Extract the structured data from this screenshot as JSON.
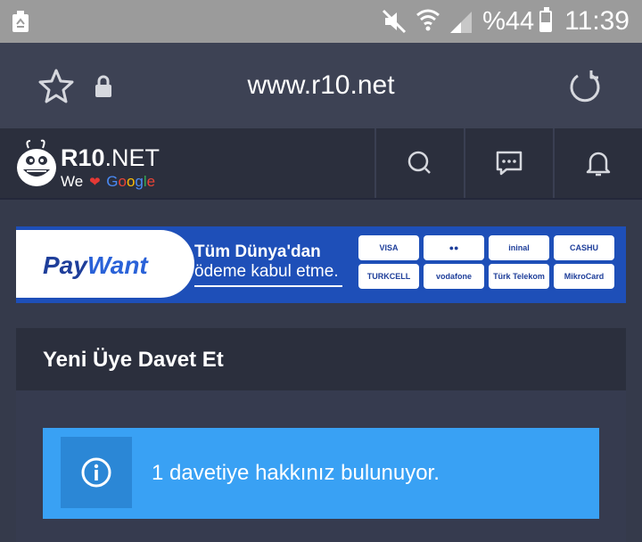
{
  "status_bar": {
    "battery_text": "%44",
    "battery_level": 0.44,
    "time": "11:39"
  },
  "browser": {
    "url": "www.r10.net"
  },
  "site": {
    "logo_title_bold": "R10",
    "logo_title_rest": ".NET",
    "logo_sub_we": "We",
    "logo_sub_heart": "❤",
    "logo_sub_google": [
      "G",
      "o",
      "o",
      "g",
      "l",
      "e"
    ]
  },
  "banner": {
    "logo_a": "Pay",
    "logo_b": "Want",
    "line1": "Tüm Dünya'dan",
    "line2": "ödeme kabul etme.",
    "methods": [
      "VISA",
      "●●",
      "ininal",
      "CASHU",
      "TURKCELL",
      "vodafone",
      "Türk Telekom",
      "MikroCard"
    ]
  },
  "panel": {
    "title": "Yeni Üye Davet Et",
    "alert_text": "1 davetiye hakkınız bulunuyor."
  },
  "colors": {
    "status_bar": "#9b9b9b",
    "url_bar": "#3d4254",
    "site_header": "#2b2f3d",
    "page_bg": "#353a4b",
    "alert": "#39a1f4",
    "alert_icon_bg": "#2b87d6",
    "banner": "#1e4fb8"
  },
  "icons": {
    "status_left": "recycle-icon",
    "mute": "mute-icon",
    "wifi": "wifi-icon",
    "signal": "signal-icon",
    "star": "star-icon",
    "lock": "lock-icon",
    "reload": "reload-icon",
    "search": "search-icon",
    "messages": "message-icon",
    "notifications": "bell-icon",
    "info": "info-icon"
  }
}
